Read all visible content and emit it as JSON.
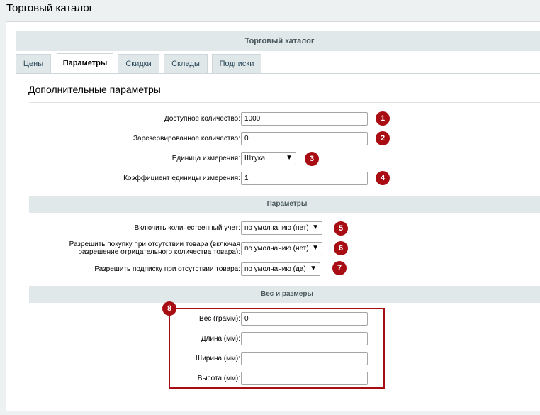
{
  "page_title": "Торговый каталог",
  "panel_header": "Торговый каталог",
  "tabs": [
    {
      "label": "Цены",
      "active": false
    },
    {
      "label": "Параметры",
      "active": true
    },
    {
      "label": "Скидки",
      "active": false
    },
    {
      "label": "Склады",
      "active": false
    },
    {
      "label": "Подписки",
      "active": false
    }
  ],
  "section_title": "Дополнительные параметры",
  "fields": {
    "available_qty": {
      "label": "Доступное количество:",
      "value": "1000",
      "badge": "1"
    },
    "reserved_qty": {
      "label": "Зарезервированное количество:",
      "value": "0",
      "badge": "2"
    },
    "unit": {
      "label": "Единица измерения:",
      "value": "Штука",
      "badge": "3"
    },
    "unit_ratio": {
      "label": "Коэффициент единицы измерения:",
      "value": "1",
      "badge": "4"
    }
  },
  "params_header": "Параметры",
  "params": {
    "qty_tracking": {
      "label": "Включить количественный учет:",
      "value": "по умолчанию (нет)",
      "badge": "5"
    },
    "allow_purchase": {
      "label_line1": "Разрешить покупку при отсутствии товара (включая",
      "label_line2": "разрешение отрицательного количества товара):",
      "value": "по умолчанию (нет)",
      "badge": "6"
    },
    "allow_subscribe": {
      "label": "Разрешить подписку при отсутствии товара:",
      "value": "по умолчанию (да)",
      "badge": "7"
    }
  },
  "weight_header": "Вес и размеры",
  "dimensions": {
    "badge": "8",
    "weight": {
      "label": "Вес (грамм):",
      "value": "0"
    },
    "length": {
      "label": "Длина (мм):",
      "value": ""
    },
    "width": {
      "label": "Ширина (мм):",
      "value": ""
    },
    "height": {
      "label": "Высота (мм):",
      "value": ""
    }
  },
  "colors": {
    "badge": "#a90d14",
    "header_bg": "#e0e8ea"
  }
}
